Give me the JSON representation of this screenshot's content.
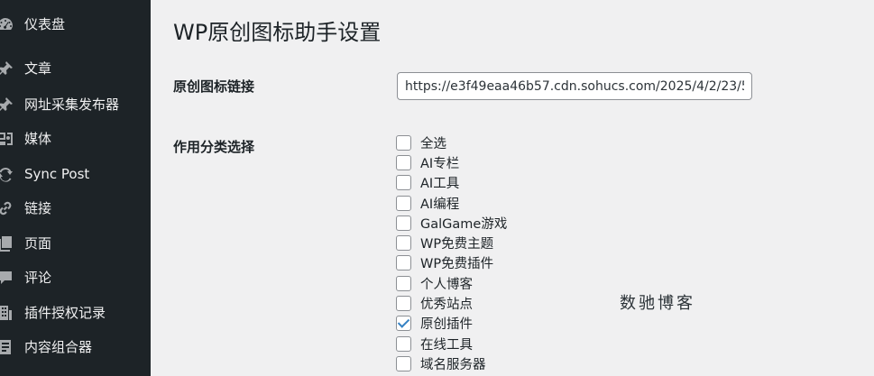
{
  "sidebar": {
    "items": [
      {
        "label": "仪表盘",
        "icon": "dashboard-icon"
      },
      {
        "label": "文章",
        "icon": "pin-icon"
      },
      {
        "label": "网址采集发布器",
        "icon": "pin-icon"
      },
      {
        "label": "媒体",
        "icon": "media-icon"
      },
      {
        "label": "Sync Post",
        "icon": "sync-icon"
      },
      {
        "label": "链接",
        "icon": "link-icon"
      },
      {
        "label": "页面",
        "icon": "pages-icon"
      },
      {
        "label": "评论",
        "icon": "comment-icon"
      },
      {
        "label": "插件授权记录",
        "icon": "building-icon"
      },
      {
        "label": "内容组合器",
        "icon": "document-icon"
      }
    ]
  },
  "main": {
    "title": "WP原创图标助手设置",
    "icon_url_label": "原创图标链接",
    "icon_url_value": "https://e3f49eaa46b57.cdn.sohucs.com/2025/4/2/23/5",
    "category_label": "作用分类选择",
    "categories": [
      {
        "label": "全选",
        "checked": false
      },
      {
        "label": "AI专栏",
        "checked": false
      },
      {
        "label": "AI工具",
        "checked": false
      },
      {
        "label": "AI编程",
        "checked": false
      },
      {
        "label": "GalGame游戏",
        "checked": false
      },
      {
        "label": "WP免费主题",
        "checked": false
      },
      {
        "label": "WP免费插件",
        "checked": false
      },
      {
        "label": "个人博客",
        "checked": false
      },
      {
        "label": "优秀站点",
        "checked": false
      },
      {
        "label": "原创插件",
        "checked": true
      },
      {
        "label": "在线工具",
        "checked": false
      },
      {
        "label": "域名服务器",
        "checked": false
      }
    ],
    "watermark": "数驰博客"
  },
  "colors": {
    "sidebar_bg": "#1d2327",
    "content_bg": "#f0f0f1",
    "checkmark": "#3582c4"
  }
}
